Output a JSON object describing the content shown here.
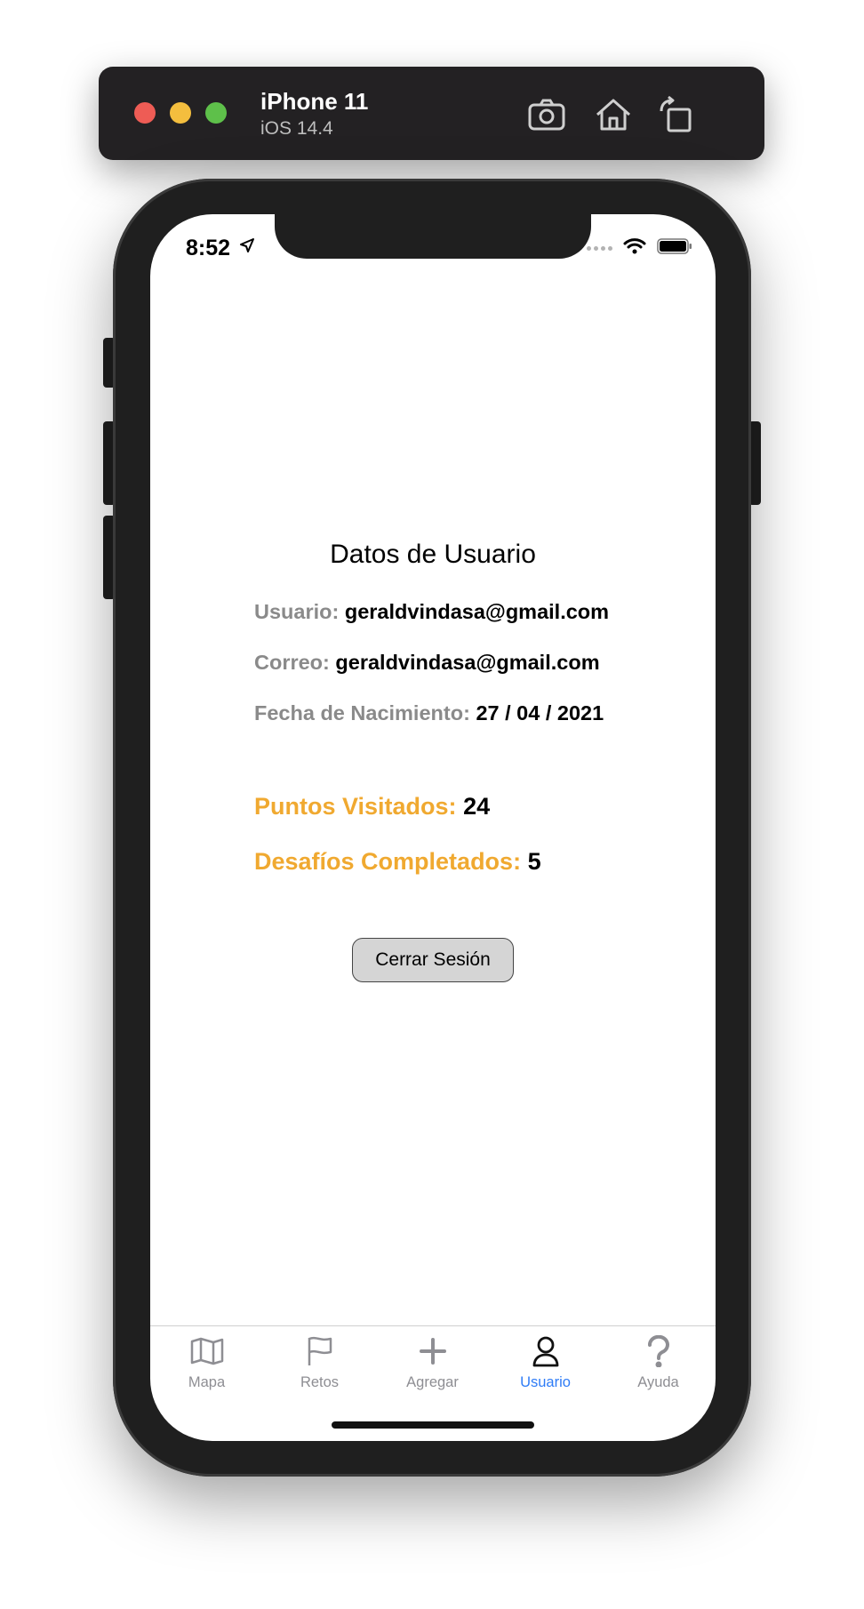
{
  "simulator": {
    "device": "iPhone 11",
    "os": "iOS 14.4",
    "tools": [
      "screenshot-icon",
      "home-icon",
      "rotate-icon"
    ]
  },
  "status_bar": {
    "time": "8:52"
  },
  "page": {
    "title": "Datos de Usuario",
    "user_label": "Usuario:",
    "user_value": "geraldvindasa@gmail.com",
    "email_label": "Correo:",
    "email_value": "geraldvindasa@gmail.com",
    "birth_label": "Fecha de Nacimiento:",
    "birth_value": "27 / 04 / 2021",
    "visited_label": "Puntos Visitados:",
    "visited_value": "24",
    "challenges_label": "Desafíos Completados:",
    "challenges_value": "5",
    "logout_button": "Cerrar Sesión"
  },
  "tabs": [
    {
      "label": "Mapa",
      "icon": "map-icon",
      "active": false
    },
    {
      "label": "Retos",
      "icon": "flag-icon",
      "active": false
    },
    {
      "label": "Agregar",
      "icon": "plus-icon",
      "active": false
    },
    {
      "label": "Usuario",
      "icon": "person-icon",
      "active": true
    },
    {
      "label": "Ayuda",
      "icon": "question-icon",
      "active": false
    }
  ],
  "colors": {
    "accent": "#2f7cf6",
    "highlight": "#f0a930",
    "muted": "#8e8e93"
  }
}
